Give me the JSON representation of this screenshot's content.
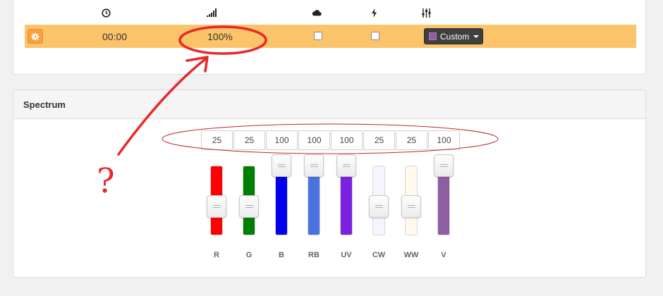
{
  "schedule_row": {
    "time": "00:00",
    "intensity": "100%",
    "cloud_checked": false,
    "lightning_checked": false,
    "preset_label": "Custom",
    "preset_color": "#8e5ea2",
    "row_color": "#fcc46a"
  },
  "headers": {
    "icons": [
      "clock-icon",
      "signal-bars-icon",
      "cloud-icon",
      "lightning-icon",
      "sliders-icon"
    ]
  },
  "spectrum": {
    "title": "Spectrum",
    "channels": [
      {
        "label": "R",
        "value": "25",
        "level": 25,
        "color": "#ff0000"
      },
      {
        "label": "G",
        "value": "25",
        "level": 25,
        "color": "#008000"
      },
      {
        "label": "B",
        "value": "100",
        "level": 100,
        "color": "#0000ee"
      },
      {
        "label": "RB",
        "value": "100",
        "level": 100,
        "color": "#4a72e0"
      },
      {
        "label": "UV",
        "value": "100",
        "level": 100,
        "color": "#7a22e0"
      },
      {
        "label": "CW",
        "value": "25",
        "level": 25,
        "color": "#f4f5ff"
      },
      {
        "label": "WW",
        "value": "25",
        "level": 25,
        "color": "#fffaed"
      },
      {
        "label": "V",
        "value": "100",
        "level": 100,
        "color": "#8e5ea2"
      }
    ]
  },
  "annotation": {
    "question_mark": "?",
    "color": "#e8282a"
  }
}
